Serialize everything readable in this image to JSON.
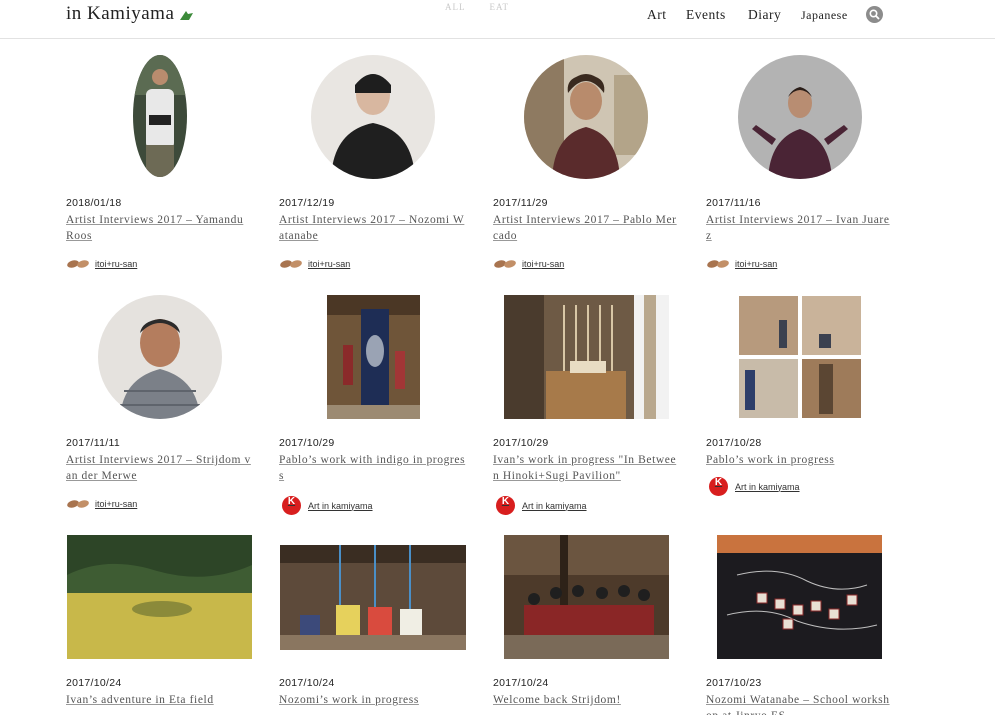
{
  "site": {
    "logo": "in Kamiyama",
    "ghost_tabs": [
      "ALL",
      "EAT"
    ]
  },
  "nav": {
    "items": [
      "Art",
      "Events",
      "Diary",
      "Japanese"
    ]
  },
  "posts": [
    {
      "date": "2018/01/18",
      "title": "Artist Interviews 2017 – Yamandu Roos",
      "author": "itoi+ru-san"
    },
    {
      "date": "2017/12/19",
      "title": "Artist Interviews 2017 – Nozomi Watanabe",
      "author": "itoi+ru-san"
    },
    {
      "date": "2017/11/29",
      "title": "Artist Interviews 2017 – Pablo Mercado",
      "author": "itoi+ru-san"
    },
    {
      "date": "2017/11/16",
      "title": "Artist Interviews 2017 – Ivan Juarez",
      "author": "itoi+ru-san"
    },
    {
      "date": "2017/11/11",
      "title": "Artist Interviews 2017 – Strijdom van der Merwe",
      "author": "itoi+ru-san"
    },
    {
      "date": "2017/10/29",
      "title": "Pablo’s work with indigo in progress",
      "author": "Art in kamiyama"
    },
    {
      "date": "2017/10/29",
      "title": "Ivan’s work in progress \"In Between Hinoki+Sugi Pavilion\"",
      "author": "Art in kamiyama"
    },
    {
      "date": "2017/10/28",
      "title": "Pablo’s work in progress",
      "author": "Art in kamiyama"
    },
    {
      "date": "2017/10/24",
      "title": "Ivan’s adventure in Eta field",
      "author": ""
    },
    {
      "date": "2017/10/24",
      "title": "Nozomi’s work in progress",
      "author": ""
    },
    {
      "date": "2017/10/24",
      "title": "Welcome back Strijdom!",
      "author": ""
    },
    {
      "date": "2017/10/23",
      "title": "Nozomi Watanabe – School workshop at Jinryo ES",
      "author": ""
    }
  ],
  "colors": {
    "accent_red": "#d81e1e",
    "leaf_green": "#3c8a3a",
    "title_text": "#555555"
  }
}
